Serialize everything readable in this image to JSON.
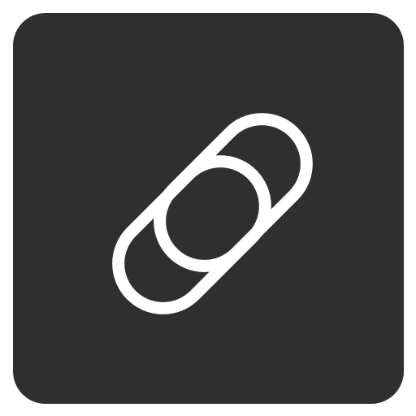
{
  "icon": {
    "name": "link-icon",
    "tile_color": "#2f2f2f",
    "stroke_color": "#ffffff"
  }
}
